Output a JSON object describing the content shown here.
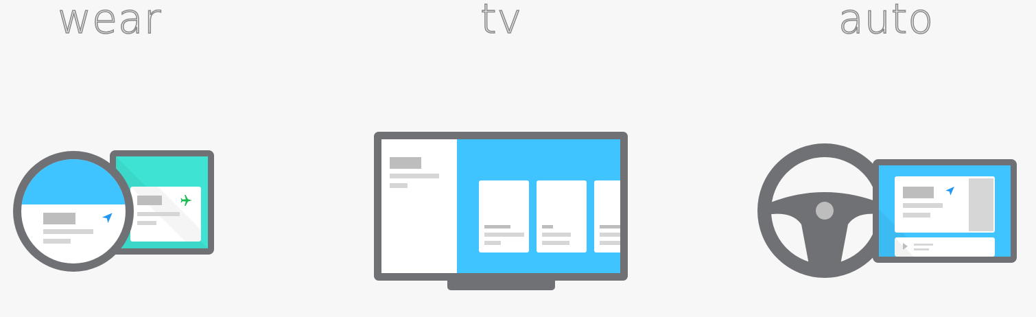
{
  "sections": [
    {
      "id": "wear",
      "label": "wear"
    },
    {
      "id": "tv",
      "label": "tv"
    },
    {
      "id": "auto",
      "label": "auto"
    }
  ],
  "colors": {
    "background": "#f7f7f7",
    "device_frame": "#707174",
    "screen_blue": "#40c4ff",
    "screen_teal": "#3fe3d3",
    "placeholder_dark": "#bdbdbd",
    "placeholder_light": "#d6d6d6",
    "card": "#ffffff",
    "arrow_blue": "#2196f3",
    "plane_green": "#1dbb53"
  },
  "icons": [
    "navigation-arrow-icon",
    "airplane-icon",
    "play-icon",
    "steering-wheel-icon"
  ]
}
